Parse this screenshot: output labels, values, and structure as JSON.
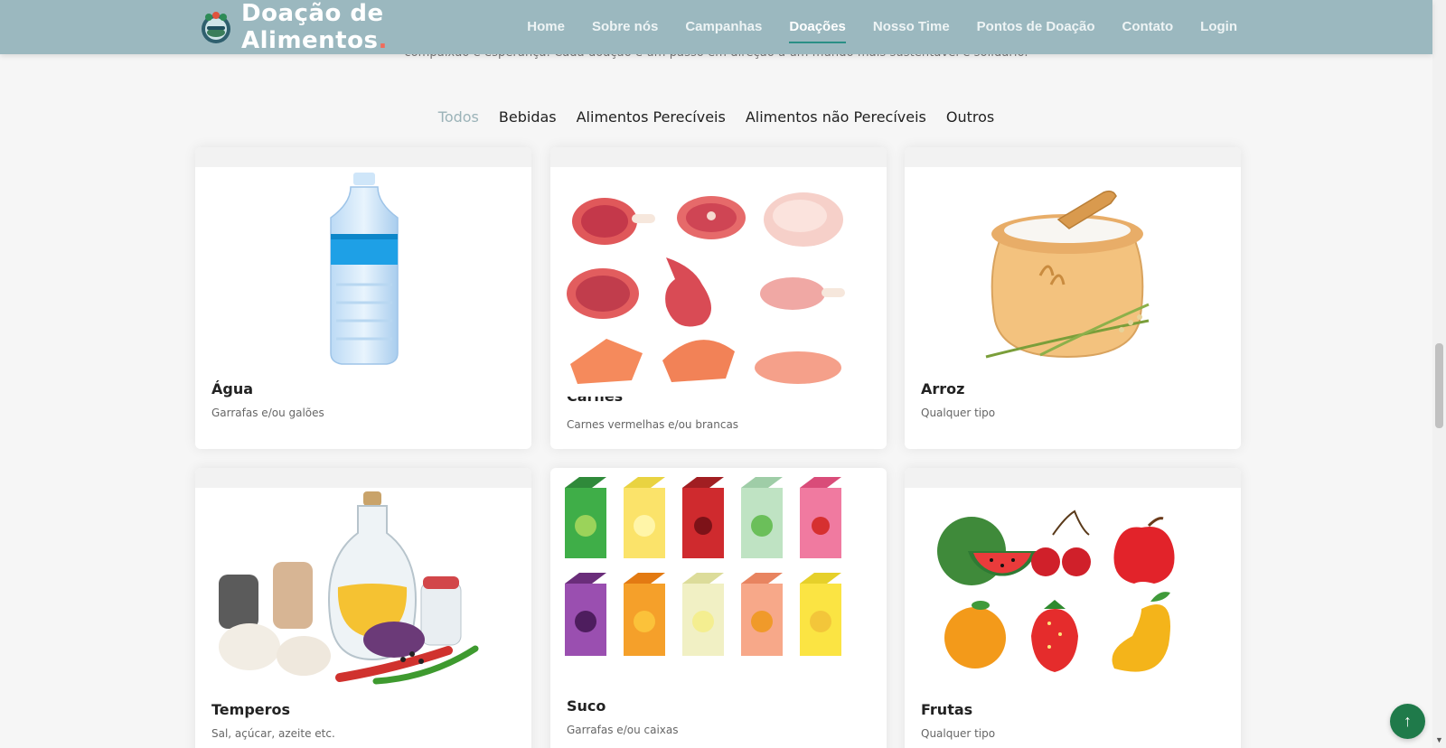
{
  "intro": {
    "text": "compaixão e esperança. Cada doação é um passo em direção a um mundo mais sustentável e solidário."
  },
  "header": {
    "brand_line1": "Doação de",
    "brand_line2": "Alimentos",
    "brand_dot": ".",
    "nav": [
      {
        "label": "Home"
      },
      {
        "label": "Sobre nós"
      },
      {
        "label": "Campanhas"
      },
      {
        "label": "Doações",
        "active": true
      },
      {
        "label": "Nosso Time"
      },
      {
        "label": "Pontos de Doação"
      },
      {
        "label": "Contato"
      },
      {
        "label": "Login"
      }
    ]
  },
  "filters": [
    {
      "label": "Todos",
      "active": true
    },
    {
      "label": "Bebidas"
    },
    {
      "label": "Alimentos Perecíveis"
    },
    {
      "label": "Alimentos não Perecíveis"
    },
    {
      "label": "Outros"
    }
  ],
  "cards": [
    {
      "title": "Água",
      "desc": "Garrafas e/ou galões",
      "icon": "water-bottle-icon"
    },
    {
      "title": "Carnes",
      "desc": "Carnes vermelhas e/ou brancas",
      "icon": "meat-icon"
    },
    {
      "title": "Arroz",
      "desc": "Qualquer tipo",
      "icon": "rice-sack-icon"
    },
    {
      "title": "Temperos",
      "desc": "Sal, açúcar, azeite etc.",
      "icon": "spices-icon"
    },
    {
      "title": "Suco",
      "desc": "Garrafas e/ou caixas",
      "icon": "juice-boxes-icon"
    },
    {
      "title": "Frutas",
      "desc": "Qualquer tipo",
      "icon": "fruits-icon"
    }
  ],
  "back_to_top": {
    "icon": "arrow-up-icon",
    "glyph": "↑"
  },
  "colors": {
    "header": "#9bb8bf",
    "active_filter": "#9bb3b8",
    "nav_underline": "#2a8f86",
    "logo_dot": "#f26b5b",
    "back_to_top": "#1f7a4a"
  }
}
